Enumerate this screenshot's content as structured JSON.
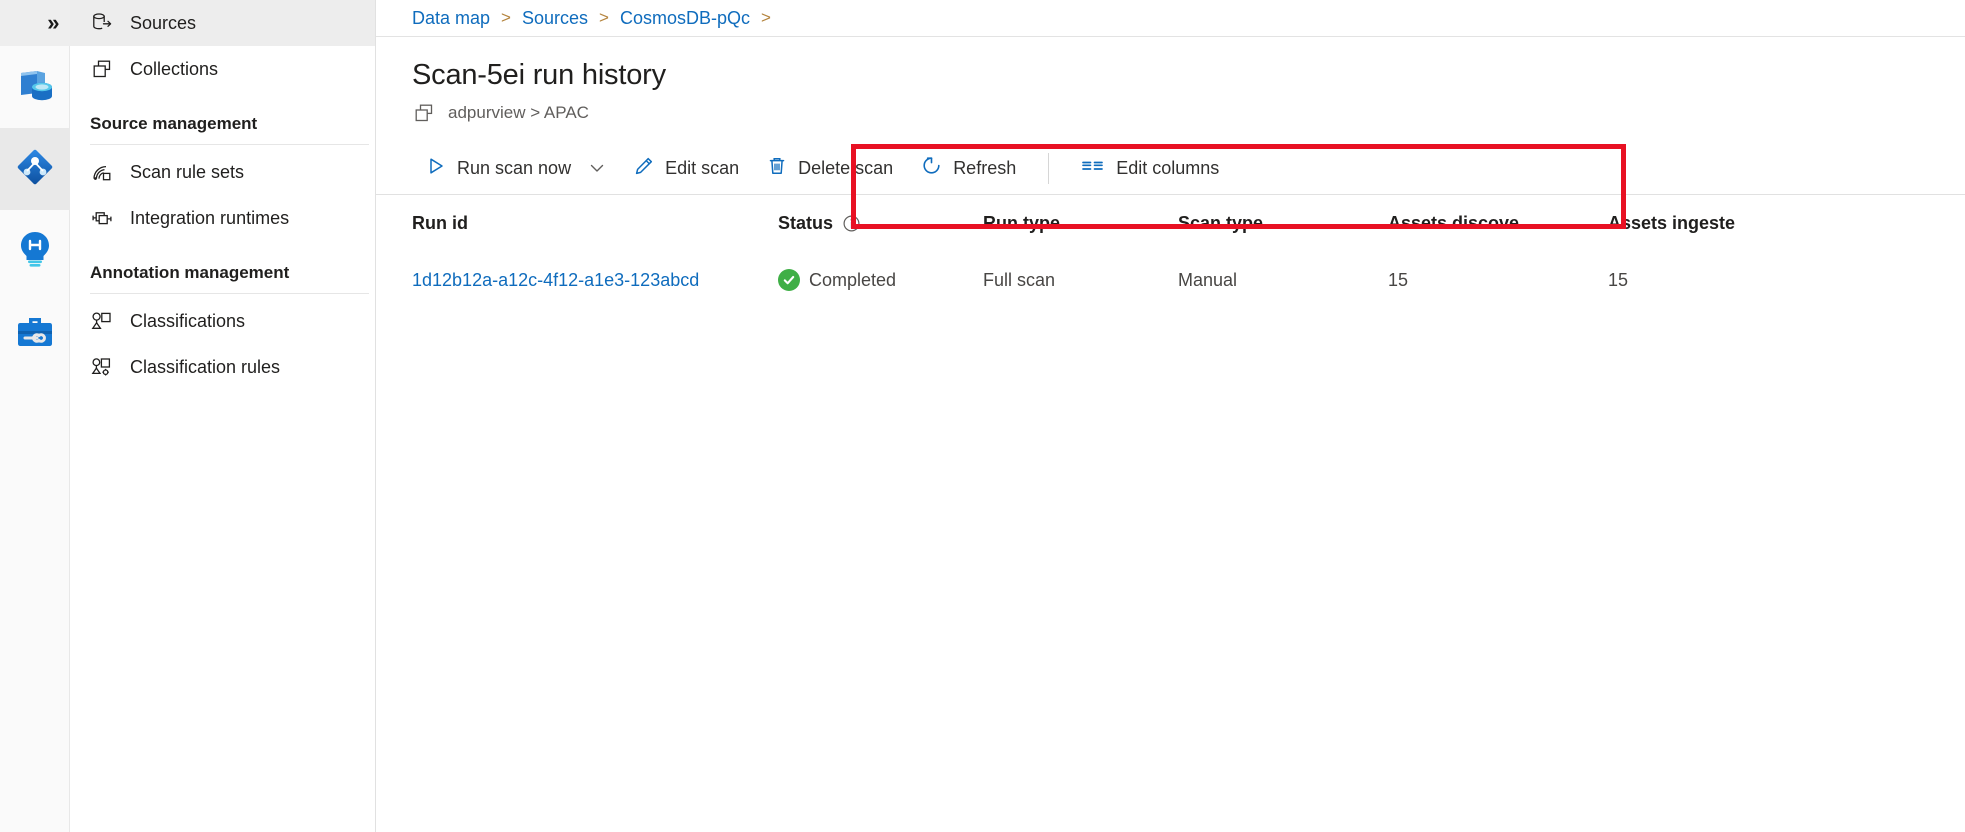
{
  "rail": {
    "expand_label": "»",
    "items": [
      {
        "name": "data-catalog",
        "title": "Data catalog",
        "active": false
      },
      {
        "name": "data-map",
        "title": "Data map",
        "active": true
      },
      {
        "name": "data-insights",
        "title": "Data insights",
        "active": false
      },
      {
        "name": "management",
        "title": "Management",
        "active": false
      }
    ]
  },
  "sidebar": {
    "items": [
      {
        "label": "Sources",
        "icon": "sources-icon",
        "selected": true
      },
      {
        "label": "Collections",
        "icon": "collections-icon",
        "selected": false
      }
    ],
    "sections": [
      {
        "title": "Source management",
        "items": [
          {
            "label": "Scan rule sets",
            "icon": "scan-rule-sets-icon"
          },
          {
            "label": "Integration runtimes",
            "icon": "integration-runtimes-icon"
          }
        ]
      },
      {
        "title": "Annotation management",
        "items": [
          {
            "label": "Classifications",
            "icon": "classifications-icon"
          },
          {
            "label": "Classification rules",
            "icon": "classification-rules-icon"
          }
        ]
      }
    ]
  },
  "breadcrumb": {
    "separator": ">",
    "items": [
      {
        "label": "Data map"
      },
      {
        "label": "Sources"
      },
      {
        "label": "CosmosDB-pQc"
      }
    ],
    "trailing_separator": ">"
  },
  "page": {
    "title": "Scan-5ei run history",
    "subtitle": "adpurview > APAC",
    "subtitle_icon": "collections-icon"
  },
  "toolbar": {
    "run_scan_now": "Run scan now",
    "edit_scan": "Edit scan",
    "delete_scan": "Delete scan",
    "refresh": "Refresh",
    "edit_columns": "Edit columns",
    "highlight_color": "#e81123"
  },
  "table": {
    "headers": {
      "run_id": "Run id",
      "status": "Status",
      "run_type": "Run type",
      "scan_type": "Scan type",
      "assets_discovered": "Assets discove...",
      "assets_ingested": "Assets ingeste"
    },
    "rows": [
      {
        "run_id": "1d12b12a-a12c-4f12-a1e3-123abcd",
        "status": "Completed",
        "status_icon": "success-check-icon",
        "status_color": "#3faf46",
        "run_type": "Full scan",
        "scan_type": "Manual",
        "assets_discovered": "15",
        "assets_ingested": "15"
      }
    ]
  },
  "colors": {
    "link": "#0f6cbd",
    "accent": "#0f6cbd",
    "success": "#3faf46",
    "highlight": "#e81123"
  }
}
